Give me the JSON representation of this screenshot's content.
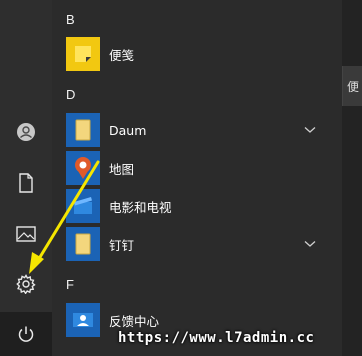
{
  "sections": [
    {
      "letter": "B",
      "apps": [
        {
          "label": "便笺",
          "icon": "sticky-notes-icon",
          "tile_color": "#f2c811"
        }
      ]
    },
    {
      "letter": "D",
      "apps": [
        {
          "label": "Daum",
          "icon": "folder-icon",
          "tile_color": "#1b63b5",
          "expandable": true
        },
        {
          "label": "地图",
          "icon": "maps-icon",
          "tile_color": "#1b63b5"
        },
        {
          "label": "电影和电视",
          "icon": "movies-tv-icon",
          "tile_color": "#1b63b5"
        },
        {
          "label": "钉钉",
          "icon": "folder-icon",
          "tile_color": "#1b63b5",
          "expandable": true
        }
      ]
    },
    {
      "letter": "F",
      "apps": [
        {
          "label": "反馈中心",
          "icon": "feedback-hub-icon",
          "tile_color": "#1b63b5"
        }
      ]
    }
  ],
  "rail": [
    "user-icon",
    "documents-icon",
    "pictures-icon",
    "settings-icon",
    "power-icon"
  ],
  "right_edge_text": "便",
  "watermark": "https://www.l7admin.cc",
  "colors": {
    "accent_tile": "#1b63b5",
    "arrow": "#f5e600"
  }
}
